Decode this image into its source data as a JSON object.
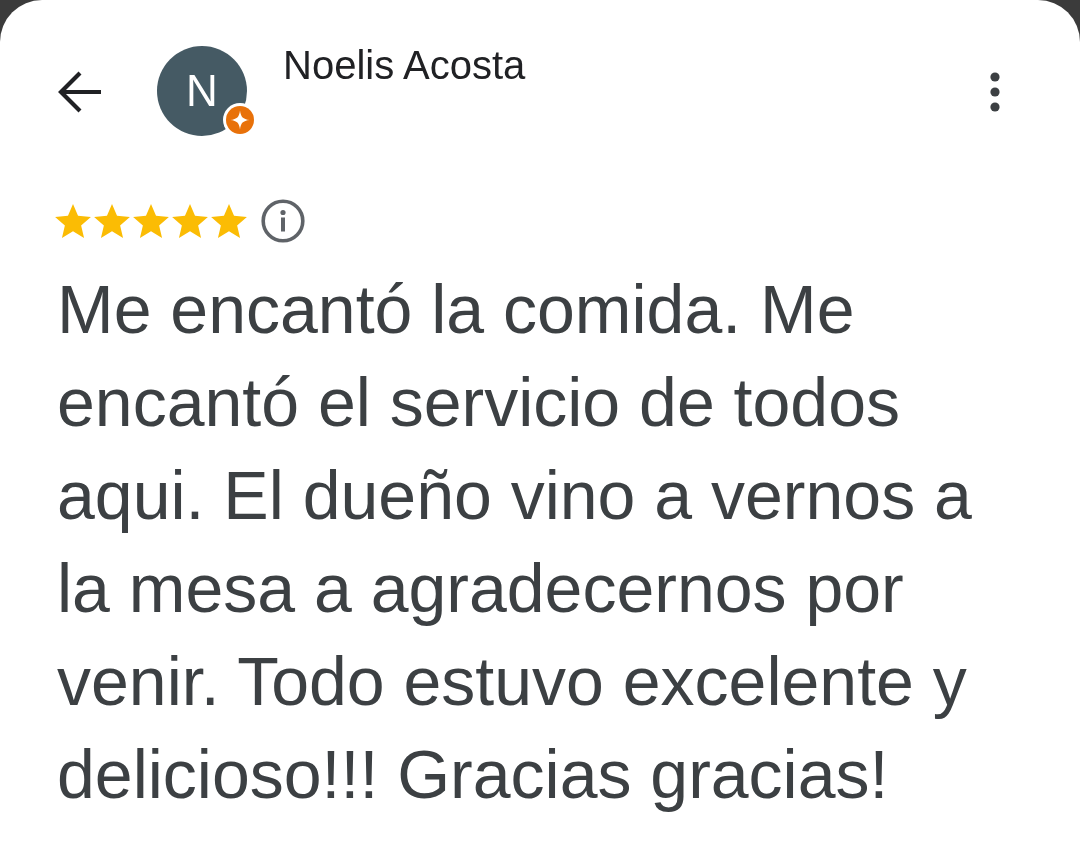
{
  "header": {
    "avatar_initial": "N",
    "local_guide": true,
    "reviewer_name": "Noelis Acosta"
  },
  "review": {
    "stars": 5,
    "text": "Me encantó la comida. Me encantó el servicio de todos aqui. El dueño vino a vernos a la mesa a agradecernos por venir. Todo estuvo excelente y delicioso!!! Gracias gracias!"
  }
}
